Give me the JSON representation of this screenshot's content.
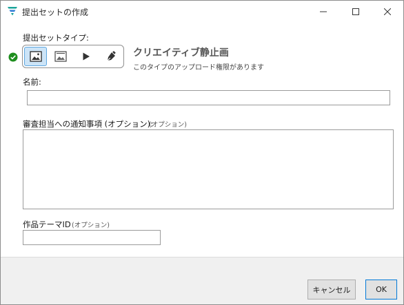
{
  "window": {
    "title": "提出セットの作成"
  },
  "form": {
    "submission_type_label": "提出セットタイプ:",
    "selected_type_title": "クリエイティブ静止画",
    "selected_type_description": "このタイプのアップロード権限があります",
    "name_label": "名前:",
    "name_value": "",
    "notes_label": "審査担当への通知事項 (オプション):",
    "notes_optional": "(オプション)",
    "notes_value": "",
    "theme_label": "作品テーマID",
    "theme_optional": "(オプション)",
    "theme_value": ""
  },
  "types": [
    {
      "icon": "image-icon",
      "selected": true
    },
    {
      "icon": "document-image-icon",
      "selected": false
    },
    {
      "icon": "play-icon",
      "selected": false
    },
    {
      "icon": "pen-icon",
      "selected": false
    }
  ],
  "buttons": {
    "cancel": "キャンセル",
    "ok": "OK"
  },
  "colors": {
    "accent": "#0078d7",
    "selected_bg": "#cce4f7",
    "check_green": "#1e8e1e",
    "logo_teal": "#1aa39a",
    "logo_blue": "#2d7ad6"
  }
}
